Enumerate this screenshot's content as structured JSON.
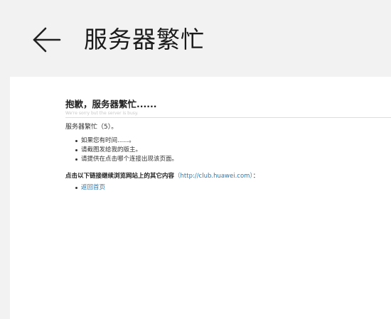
{
  "appbar": {
    "back_icon": "arrow-left-icon",
    "title": "服务器繁忙"
  },
  "page": {
    "error_title": "抱歉，服务器繁忙......",
    "error_subtitle": "We're sorry but the server is busy.",
    "message": "服务器繁忙（5）。",
    "tips": [
      "如果您有时间......。",
      "请截图发给我的版主。",
      "请提供在点击哪个连接出现该页面。"
    ],
    "continue_prefix": "点击以下链接继续浏览网站上的其它内容",
    "continue_link": "（http://club.huawei.com）",
    "continue_suffix": "：",
    "links": [
      "返回首页"
    ]
  },
  "colors": {
    "background": "#f2f2f2",
    "card": "#ffffff",
    "link": "#2a7ab8"
  }
}
